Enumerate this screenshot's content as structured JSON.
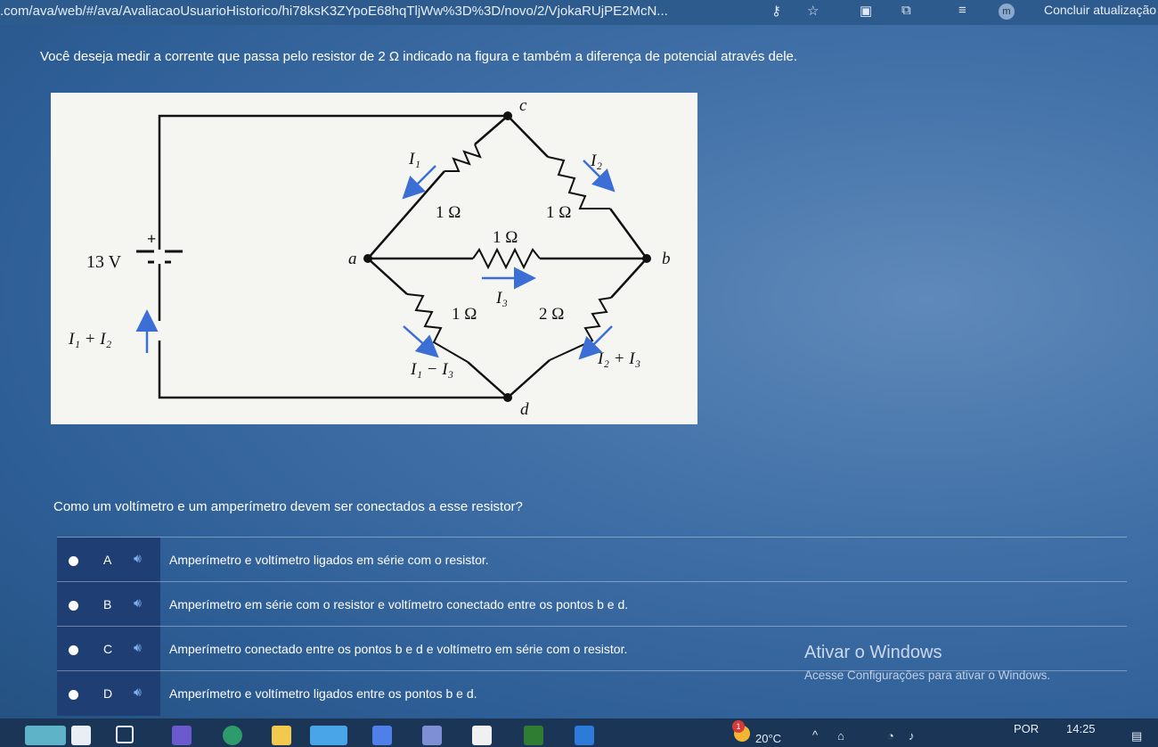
{
  "browser": {
    "url": ".com/ava/web/#/ava/AvaliacaoUsuarioHistorico/hi78ksK3ZYpoE68hqTljWw%3D%3D/novo/2/VjokaRUjPE2McN...",
    "profile_letter": "m",
    "update_label": "Concluir atualização"
  },
  "question": {
    "statement": "Você deseja medir a corrente que passa pelo resistor de 2 Ω indicado na figura e também a diferença de potencial através dele.",
    "prompt": "Como um voltímetro e um amperímetro devem ser conectados a esse resistor?"
  },
  "circuit": {
    "battery_voltage": "13 V",
    "battery_plus": "+",
    "left_current": "I₁ + I₂",
    "node_a": "a",
    "node_b": "b",
    "node_c": "c",
    "node_d": "d",
    "r_ac": "1 Ω",
    "r_cb": "1 Ω",
    "r_ab": "1 Ω",
    "r_ad": "1 Ω",
    "r_db": "2 Ω",
    "i1": "I₁",
    "i2": "I₂",
    "i3": "I₃",
    "i1_minus_i3": "I₁ − I₃",
    "i2_plus_i3": "I₂ + I₃"
  },
  "options": [
    {
      "letter": "A",
      "text": "Amperímetro e voltímetro ligados em série com o resistor."
    },
    {
      "letter": "B",
      "text": "Amperímetro em série com o resistor e voltímetro conectado entre os pontos b e d."
    },
    {
      "letter": "C",
      "text": "Amperímetro conectado entre os pontos b e d e voltímetro em série com o resistor."
    },
    {
      "letter": "D",
      "text": "Amperímetro e voltímetro ligados entre os pontos b e d."
    }
  ],
  "watermark": {
    "title": "Ativar o Windows",
    "subtitle": "Acesse Configurações para ativar o Windows."
  },
  "taskbar": {
    "weather": "20°C",
    "notification_count": "1",
    "language": "POR",
    "time": "14:25"
  },
  "colors": {
    "option_left": "#1f3f74",
    "speaker": "#7fb0f0"
  }
}
